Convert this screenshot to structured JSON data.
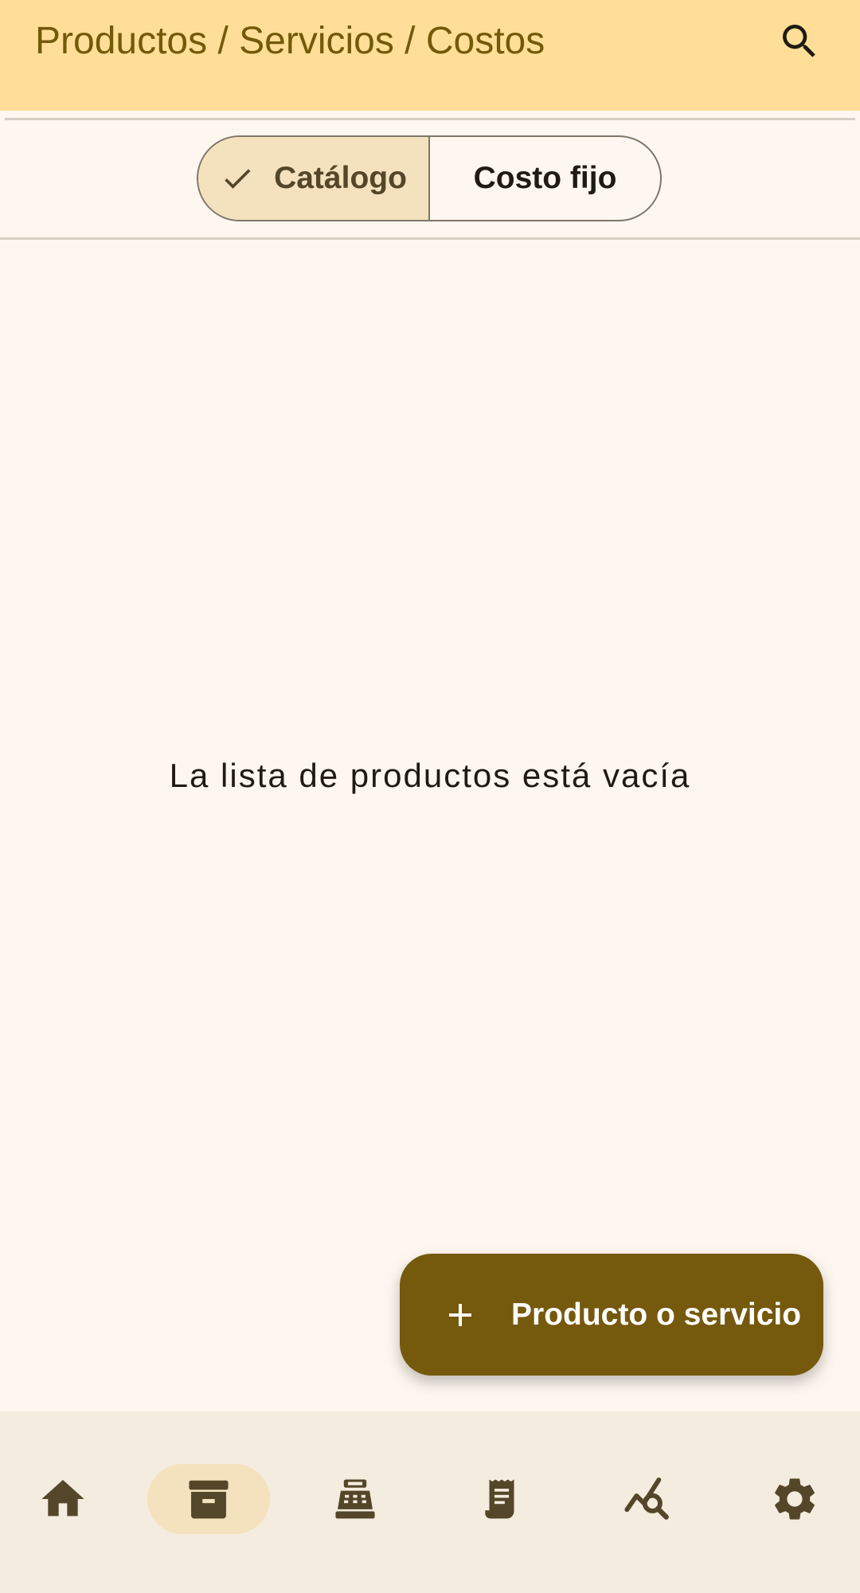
{
  "header": {
    "title": "Productos / Servicios / Costos",
    "search_icon": "search-icon"
  },
  "segmented": {
    "options": [
      {
        "label": "Catálogo",
        "selected": true,
        "icon": "check-icon"
      },
      {
        "label": "Costo fijo",
        "selected": false
      }
    ]
  },
  "empty_state": {
    "message": "La lista de productos está vacía"
  },
  "fab": {
    "label": "Producto o servicio",
    "icon": "plus-icon"
  },
  "bottom_nav": {
    "items": [
      {
        "icon": "home-icon",
        "active": false
      },
      {
        "icon": "archive-icon",
        "active": true
      },
      {
        "icon": "cash-register-icon",
        "active": false
      },
      {
        "icon": "receipt-icon",
        "active": false
      },
      {
        "icon": "chart-search-icon",
        "active": false
      },
      {
        "icon": "gear-icon",
        "active": false
      }
    ]
  },
  "colors": {
    "topbar_bg": "#FFDF98",
    "title": "#735A0A",
    "background": "#FEF7F0",
    "selected_segment": "#F4E2BE",
    "fab": "#75590D",
    "nav_bg": "#F5ECE0",
    "icon": "#544629"
  }
}
